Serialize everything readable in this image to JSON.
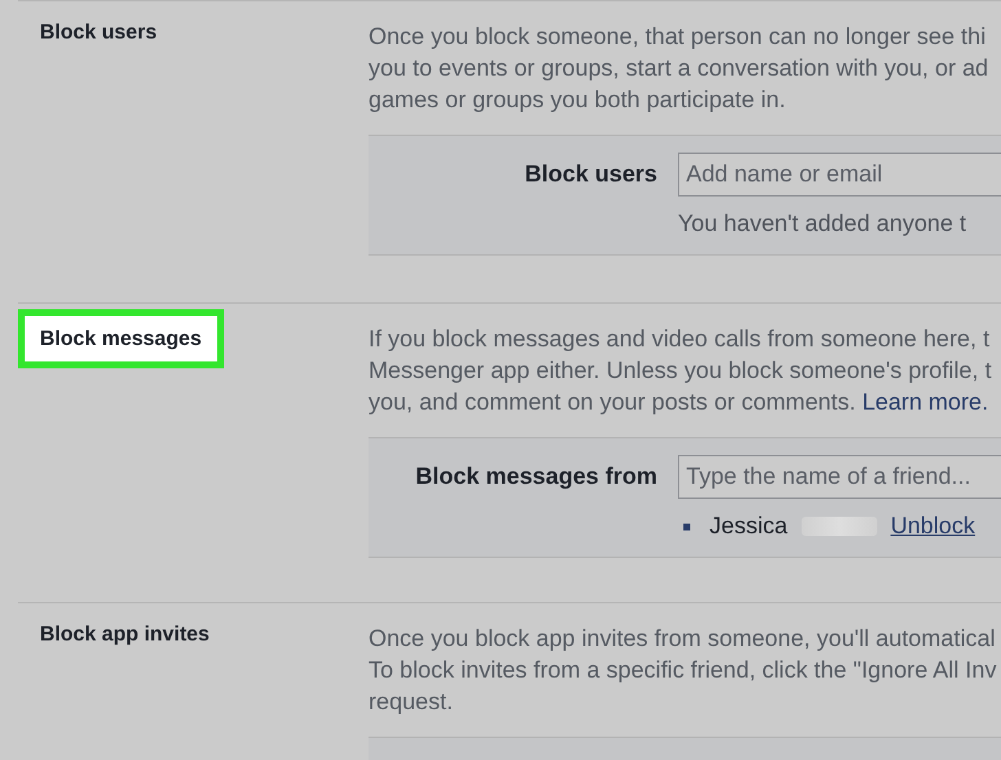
{
  "sections": [
    {
      "title": "Block users",
      "highlighted": false,
      "description": [
        {
          "text": "Once you block someone, that person can no longer see thi"
        },
        {
          "text": "you to events or groups, start a conversation with you, or ad"
        },
        {
          "text": "games or groups you both participate in."
        }
      ],
      "panel": {
        "label": "Block users",
        "placeholder": "Add name or email",
        "note": "You haven't added anyone t"
      }
    },
    {
      "title": "Block messages",
      "highlighted": true,
      "description": [
        {
          "text": "If you block messages and video calls from someone here, t"
        },
        {
          "text": "Messenger app either. Unless you block someone's profile, t"
        },
        {
          "text": "you, and comment on your posts or comments.",
          "link": "Learn more."
        }
      ],
      "panel": {
        "label": "Block messages from",
        "placeholder": "Type the name of a friend...",
        "blocked": [
          {
            "name": "Jessica",
            "action": "Unblock"
          }
        ]
      }
    },
    {
      "title": "Block app invites",
      "highlighted": false,
      "description": [
        {
          "text": "Once you block app invites from someone, you'll automatical"
        },
        {
          "text": "To block invites from a specific friend, click the \"Ignore All Inv"
        },
        {
          "text": "request."
        }
      ]
    }
  ]
}
